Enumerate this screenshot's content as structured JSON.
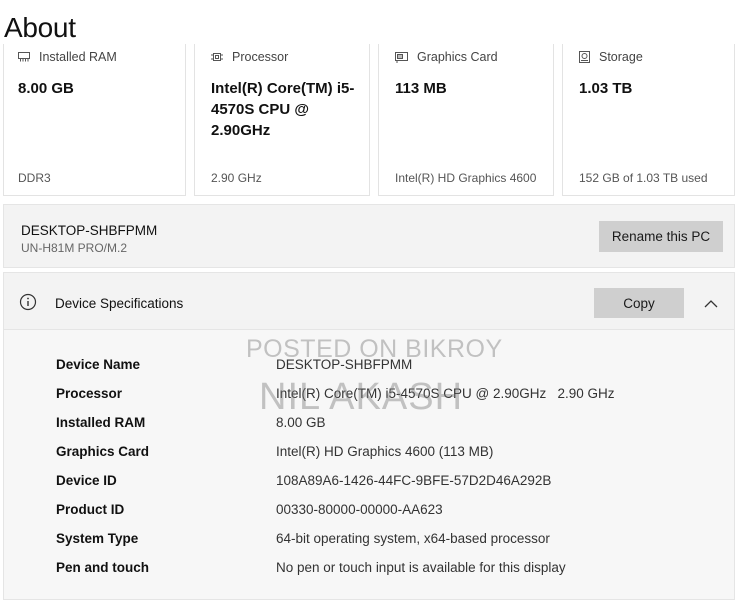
{
  "page": {
    "title": "About"
  },
  "cards": [
    {
      "icon": "ram-icon",
      "label": "Installed RAM",
      "value": "8.00 GB",
      "detail": "DDR3"
    },
    {
      "icon": "processor-icon",
      "label": "Processor",
      "value": "Intel(R) Core(TM) i5-4570S CPU @ 2.90GHz",
      "detail": "2.90 GHz"
    },
    {
      "icon": "graphics-card-icon",
      "label": "Graphics Card",
      "value": "113 MB",
      "detail": "Intel(R) HD Graphics 4600"
    },
    {
      "icon": "storage-icon",
      "label": "Storage",
      "value": "1.03 TB",
      "detail": "152 GB of 1.03 TB used"
    }
  ],
  "pc": {
    "name": "DESKTOP-SHBFPMM",
    "model": "UN-H81M PRO/M.2",
    "rename_label": "Rename this PC"
  },
  "specs": {
    "title": "Device Specifications",
    "copy_label": "Copy",
    "rows": [
      {
        "label": "Device Name",
        "value": "DESKTOP-SHBFPMM"
      },
      {
        "label": "Processor",
        "value": "Intel(R) Core(TM) i5-4570S CPU @ 2.90GHz   2.90 GHz"
      },
      {
        "label": "Installed RAM",
        "value": "8.00 GB"
      },
      {
        "label": "Graphics Card",
        "value": "Intel(R) HD Graphics 4600 (113 MB)"
      },
      {
        "label": "Device ID",
        "value": "108A89A6-1426-44FC-9BFE-57D2D46A292B"
      },
      {
        "label": "Product ID",
        "value": "00330-80000-00000-AA623"
      },
      {
        "label": "System Type",
        "value": "64-bit operating system, x64-based processor"
      },
      {
        "label": "Pen and touch",
        "value": "No pen or touch input is available for this display"
      }
    ]
  },
  "watermark": {
    "line1": "POSTED ON BIKROY",
    "line2": "NIL AKASH"
  }
}
